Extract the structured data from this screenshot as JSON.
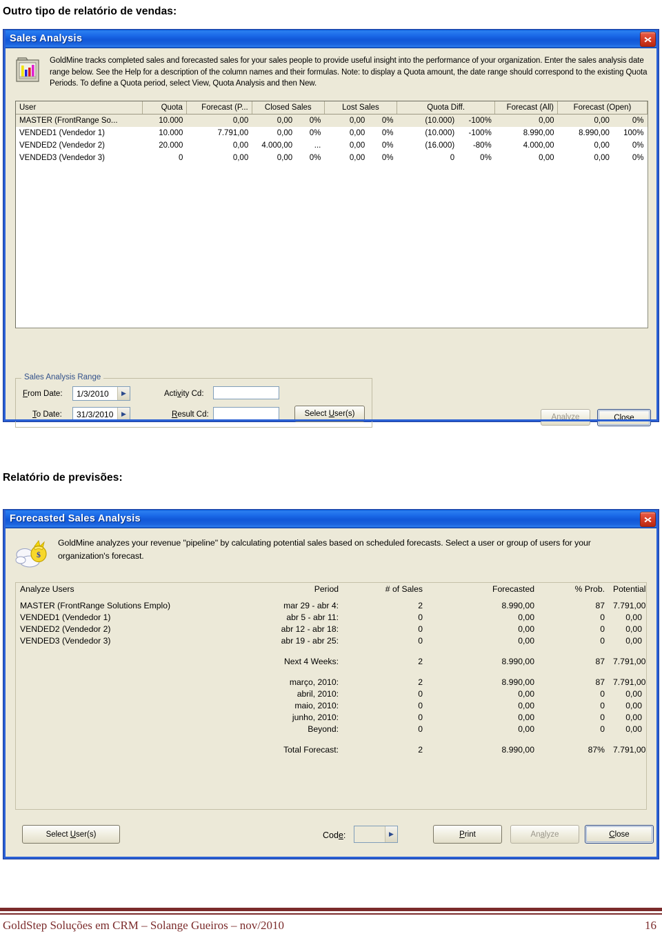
{
  "page": {
    "heading_1": "Outro tipo de relatório de vendas:",
    "heading_2": "Relatório de previsões:",
    "footer_text": "GoldStep Soluções em CRM – Solange Gueiros – nov/2010",
    "page_number": "16",
    "accent_color": "#7b2b2b",
    "titlebar_color": "#1b6ae8",
    "dialog_face_color": "#ece9d8"
  },
  "sales_analysis": {
    "title": "Sales Analysis",
    "close_icon": "close-icon",
    "banner_icon": "bar-chart-icon",
    "description": "GoldMine tracks completed sales and forecasted sales for your sales people to provide useful insight into the performance of your organization.  Enter the sales analysis date range below.  See the Help for a description of the column names and their formulas.  Note: to display a Quota amount, the date range should correspond to the existing Quota Periods. To define a Quota period, select View, Quota Analysis and then New.",
    "columns": [
      "User",
      "Quota",
      "Forecast (P...",
      "Closed Sales",
      "",
      "Lost Sales",
      "",
      "Quota Diff.",
      "",
      "Forecast (All)",
      "Forecast (Open)",
      ""
    ],
    "rows": [
      {
        "user": "MASTER (FrontRange So...",
        "quota": "10.000",
        "forecast_p": "0,00",
        "closed_sales": "0,00",
        "closed_pct": "0%",
        "lost_sales": "0,00",
        "lost_pct": "0%",
        "quota_diff": "(10.000)",
        "quota_diff_pct": "-100%",
        "forecast_all": "0,00",
        "forecast_open": "0,00",
        "forecast_open_pct": "0%",
        "selected": true
      },
      {
        "user": "VENDED1 (Vendedor 1)",
        "quota": "10.000",
        "forecast_p": "7.791,00",
        "closed_sales": "0,00",
        "closed_pct": "0%",
        "lost_sales": "0,00",
        "lost_pct": "0%",
        "quota_diff": "(10.000)",
        "quota_diff_pct": "-100%",
        "forecast_all": "8.990,00",
        "forecast_open": "8.990,00",
        "forecast_open_pct": "100%",
        "selected": false
      },
      {
        "user": "VENDED2 (Vendedor 2)",
        "quota": "20.000",
        "forecast_p": "0,00",
        "closed_sales": "4.000,00",
        "closed_pct": "...",
        "lost_sales": "0,00",
        "lost_pct": "0%",
        "quota_diff": "(16.000)",
        "quota_diff_pct": "-80%",
        "forecast_all": "4.000,00",
        "forecast_open": "0,00",
        "forecast_open_pct": "0%",
        "selected": false
      },
      {
        "user": "VENDED3 (Vendedor 3)",
        "quota": "0",
        "forecast_p": "0,00",
        "closed_sales": "0,00",
        "closed_pct": "0%",
        "lost_sales": "0,00",
        "lost_pct": "0%",
        "quota_diff": "0",
        "quota_diff_pct": "0%",
        "forecast_all": "0,00",
        "forecast_open": "0,00",
        "forecast_open_pct": "0%",
        "selected": false
      }
    ],
    "range_group": {
      "title": "Sales Analysis Range",
      "from_label": "From Date:",
      "from_value": "1/3/2010",
      "to_label": "To Date:",
      "to_value": "31/3/2010",
      "activity_label": "Activity Cd:",
      "activity_value": "",
      "result_label": "Result Cd:",
      "result_value": "",
      "select_users_label": "Select User(s)"
    },
    "buttons": {
      "analyze": "Analyze",
      "analyze_disabled": true,
      "close": "Close"
    }
  },
  "forecasted_sales_analysis": {
    "title": "Forecasted Sales Analysis",
    "close_icon": "close-icon",
    "banner_icon": "money-bag-icon",
    "description": "GoldMine analyzes your revenue \"pipeline\" by calculating potential sales based on scheduled forecasts.  Select a user or group of users for your organization's forecast.",
    "columns": {
      "users": "Analyze Users",
      "period": "Period",
      "num_sales": "# of Sales",
      "forecasted": "Forecasted",
      "prob": "% Prob.",
      "potential": "Potential"
    },
    "users": [
      "MASTER (FrontRange Solutions Emplo)",
      "VENDED1 (Vendedor 1)",
      "VENDED2 (Vendedor 2)",
      "VENDED3 (Vendedor 3)"
    ],
    "weekly_rows": [
      {
        "period": "mar 29 - abr 4:",
        "num_sales": "2",
        "forecasted": "8.990,00",
        "prob": "87",
        "potential": "7.791,00"
      },
      {
        "period": "abr 5 - abr 11:",
        "num_sales": "0",
        "forecasted": "0,00",
        "prob": "0",
        "potential": "0,00"
      },
      {
        "period": "abr 12 - abr 18:",
        "num_sales": "0",
        "forecasted": "0,00",
        "prob": "0",
        "potential": "0,00"
      },
      {
        "period": "abr 19 - abr 25:",
        "num_sales": "0",
        "forecasted": "0,00",
        "prob": "0",
        "potential": "0,00"
      }
    ],
    "next4_row": {
      "period": "Next 4 Weeks:",
      "num_sales": "2",
      "forecasted": "8.990,00",
      "prob": "87",
      "potential": "7.791,00"
    },
    "monthly_rows": [
      {
        "period": "março, 2010:",
        "num_sales": "2",
        "forecasted": "8.990,00",
        "prob": "87",
        "potential": "7.791,00"
      },
      {
        "period": "abril, 2010:",
        "num_sales": "0",
        "forecasted": "0,00",
        "prob": "0",
        "potential": "0,00"
      },
      {
        "period": "maio, 2010:",
        "num_sales": "0",
        "forecasted": "0,00",
        "prob": "0",
        "potential": "0,00"
      },
      {
        "period": "junho, 2010:",
        "num_sales": "0",
        "forecasted": "0,00",
        "prob": "0",
        "potential": "0,00"
      },
      {
        "period": "Beyond:",
        "num_sales": "0",
        "forecasted": "0,00",
        "prob": "0",
        "potential": "0,00"
      }
    ],
    "total_row": {
      "period": "Total Forecast:",
      "num_sales": "2",
      "forecasted": "8.990,00",
      "prob": "87%",
      "potential": "7.791,00"
    },
    "footer_bar": {
      "select_users_label": "Select User(s)",
      "code_label": "Code:",
      "code_value": "",
      "print_label": "Print",
      "analyze_label": "Analyze",
      "analyze_disabled": true,
      "close_label": "Close"
    }
  }
}
